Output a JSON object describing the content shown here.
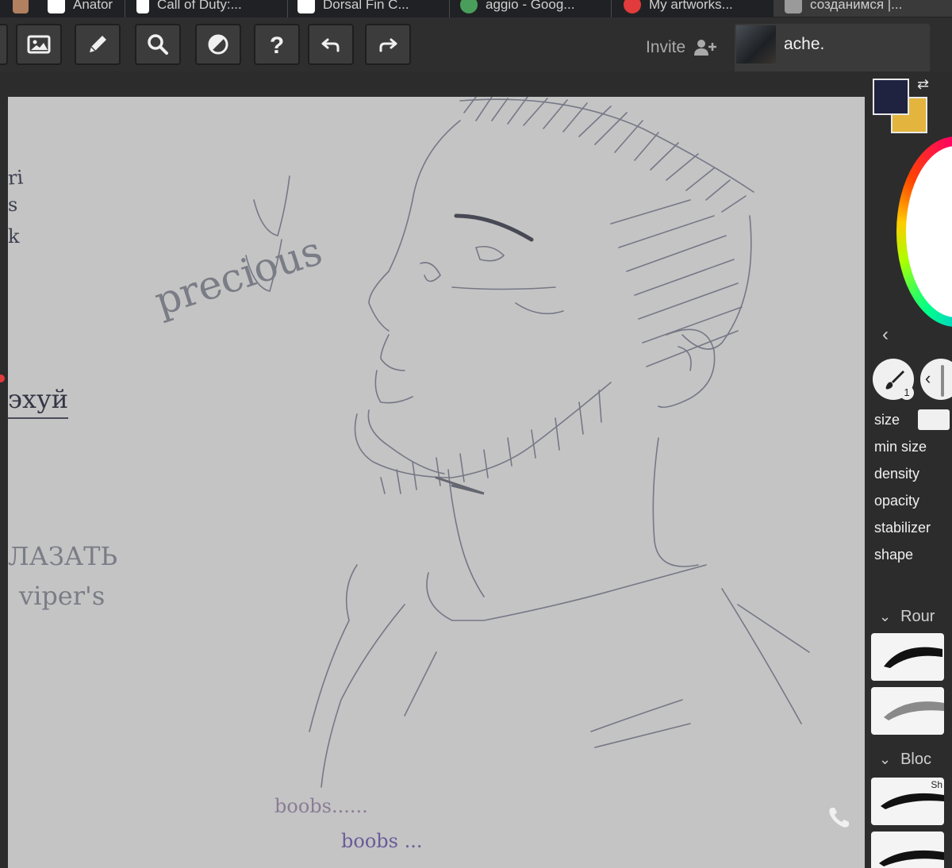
{
  "tabs": [
    {
      "label": "Anator",
      "favicon_color": "#b08060"
    },
    {
      "label": "Call of Duty:...",
      "favicon_color": "#ffffff"
    },
    {
      "label": "Dorsal Fin C...",
      "favicon_color": "#ffffff"
    },
    {
      "label": "aggio - Goog...",
      "favicon_color": "#4a9e5c"
    },
    {
      "label": "My artworks...",
      "favicon_color": "#e23b3b"
    },
    {
      "label": "созданимся |...",
      "favicon_color": "#9a9a9a"
    }
  ],
  "toolbar": {
    "buttons": [
      {
        "name": "image-icon"
      },
      {
        "name": "pencil-icon"
      },
      {
        "name": "search-icon"
      },
      {
        "name": "contrast-icon"
      },
      {
        "name": "help-icon"
      },
      {
        "name": "undo-icon"
      },
      {
        "name": "redo-icon"
      }
    ],
    "invite_label": "Invite",
    "user_name": "ache."
  },
  "colors": {
    "primary": "#1f2340",
    "secondary": "#e3b53e",
    "accent": "#3b82f6",
    "canvas": "#c4c4c4"
  },
  "panel": {
    "brush_count": "1",
    "properties": [
      "size",
      "min size",
      "density",
      "opacity",
      "stabilizer",
      "shape"
    ],
    "groups": [
      "Rour",
      "Bloc"
    ],
    "tile_label": "Sh"
  },
  "canvas_text": {
    "left_fragment_1": "ri",
    "left_fragment_2": "s",
    "left_fragment_3": "k",
    "precious": "precious",
    "cyrillic_1": "эхуй",
    "cyrillic_2": "ЛАЗАТЬ",
    "vipers": "viper's",
    "boobs_1": "boobs......",
    "boobs_2": "boobs ..."
  }
}
